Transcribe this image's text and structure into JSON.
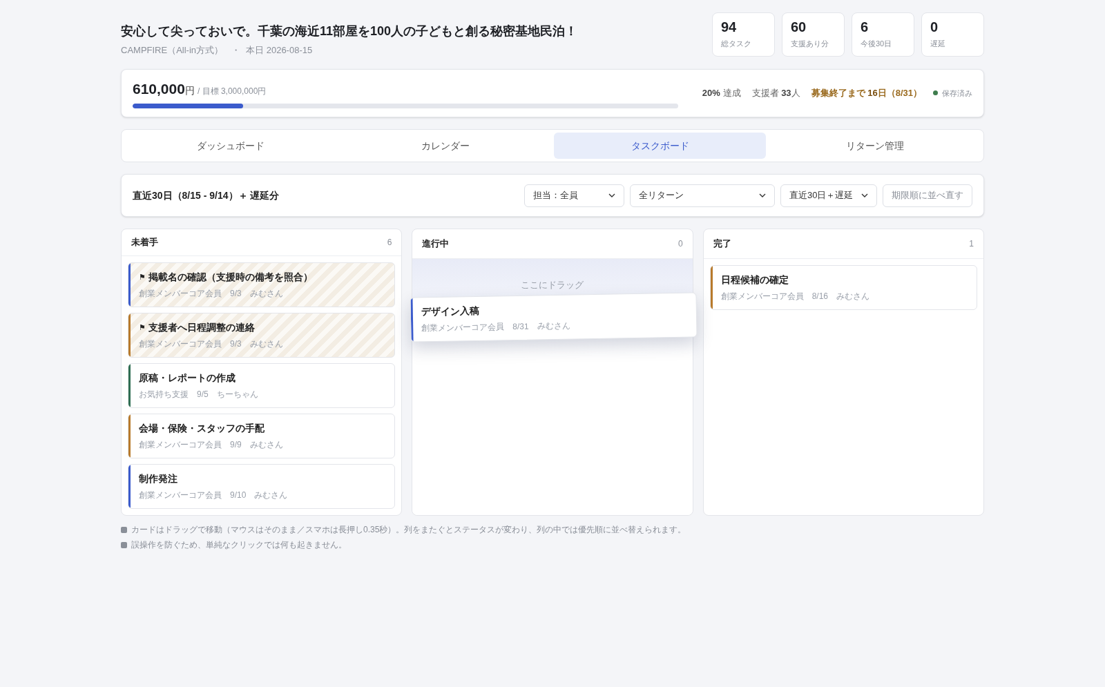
{
  "header": {
    "title": "安心して尖っておいで。千葉の海近11部屋を100人の子どもと創る秘密基地民泊！",
    "platform": "CAMPFIRE（All-in方式）",
    "separator": "・",
    "today": "本日 2026-08-15"
  },
  "stats": [
    {
      "value": "94",
      "label": "総タスク"
    },
    {
      "value": "60",
      "label": "支援あり分"
    },
    {
      "value": "6",
      "label": "今後30日"
    },
    {
      "value": "0",
      "label": "遅延"
    }
  ],
  "funding": {
    "amount": "610,000",
    "unit": "円",
    "goal": "/ 目標 3,000,000円",
    "level": 0.203,
    "percent": "20%",
    "percent_label": "達成",
    "backers_label": "支援者",
    "backers": "33",
    "backers_unit": "人",
    "deadline_label": "募集終了まで",
    "deadline_days": "16",
    "deadline_unit": "日（8/31）",
    "save_status": {
      "label": "保存済み",
      "color": "#3f7d4e"
    }
  },
  "tabs": [
    {
      "label": "ダッシュボード",
      "selected": false
    },
    {
      "label": "カレンダー",
      "selected": false
    },
    {
      "label": "タスクボード",
      "selected": true
    },
    {
      "label": "リターン管理",
      "selected": false
    }
  ],
  "filter_bar": {
    "title": "直近30日（8/15 - 9/14）＋ 遅延分",
    "selects": [
      {
        "value": "担当：全員"
      },
      {
        "value": "全リターン"
      },
      {
        "value": "直近30日＋遅延"
      }
    ],
    "sort_button": "期限順に並べ直す"
  },
  "columns": [
    {
      "title": "未着手",
      "count": "6",
      "cards": [
        {
          "kind": "flagged",
          "flag": "⚑",
          "title": "掲載名の確認（支援時の備考を照合）",
          "meta": "創業メンバーコア会員　9/3　みむさん",
          "color": "#3b5bcc"
        },
        {
          "kind": "flagged",
          "flag": "⚑",
          "title": "支援者へ日程調整の連絡",
          "meta": "創業メンバーコア会員　9/3　みむさん",
          "color": "#b87a2c"
        },
        {
          "kind": "normal",
          "title": "原稿・レポートの作成",
          "meta": "お気持ち支援　9/5　ちーちゃん",
          "color": "#2f6e52"
        },
        {
          "kind": "normal",
          "title": "会場・保険・スタッフの手配",
          "meta": "創業メンバーコア会員　9/9　みむさん",
          "color": "#b87a2c"
        },
        {
          "kind": "normal",
          "title": "制作発注",
          "meta": "創業メンバーコア会員　9/10　みむさん",
          "color": "#3b5bcc"
        }
      ]
    },
    {
      "title": "進行中",
      "count": "0",
      "drop_hint": "ここにドラッグ",
      "cards": [
        {
          "kind": "dragging",
          "title": "デザイン入稿",
          "meta": "創業メンバーコア会員　8/31　みむさん",
          "color": "#3b5bcc"
        }
      ]
    },
    {
      "title": "完了",
      "count": "1",
      "cards": [
        {
          "kind": "normal",
          "title": "日程候補の確定",
          "meta": "創業メンバーコア会員　8/16　みむさん",
          "color": "#b87a2c"
        }
      ]
    }
  ],
  "notes": [
    "カードはドラッグで移動（マウスはそのまま／スマホは長押し0.35秒）。列をまたぐとステータスが変わり、列の中では優先順に並べ替えられます。",
    "誤操作を防ぐため、単純なクリックでは何も起きません。"
  ]
}
